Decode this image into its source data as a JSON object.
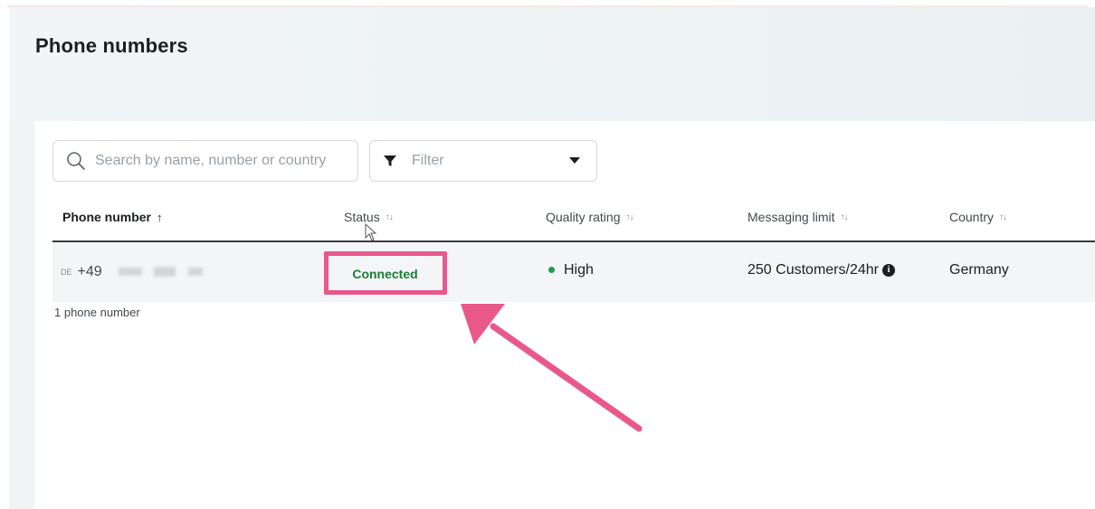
{
  "page": {
    "title": "Phone numbers"
  },
  "toolbar": {
    "search_placeholder": "Search by name, number or country",
    "filter_label": "Filter",
    "icons": {
      "search": "search-icon",
      "filter": "filter-icon",
      "dropdown": "chevron-down-icon"
    }
  },
  "table": {
    "columns": [
      {
        "label": "Phone number",
        "sort": "↑"
      },
      {
        "label": "Status",
        "sort": "↑↓"
      },
      {
        "label": "Quality rating",
        "sort": "↑↓"
      },
      {
        "label": "Messaging limit",
        "sort": "↑↓"
      },
      {
        "label": "Country",
        "sort": "↑↓"
      }
    ],
    "rows": [
      {
        "country_code": "DE",
        "phone_prefix": "+49",
        "status": "Connected",
        "quality": "High",
        "messaging_limit": "250 Customers/24hr",
        "country": "Germany"
      }
    ],
    "count_text": "1 phone number"
  },
  "colors": {
    "annotation": "#e8598a",
    "status_connected": "#1a7f37",
    "quality_high": "#1f9d4d"
  }
}
